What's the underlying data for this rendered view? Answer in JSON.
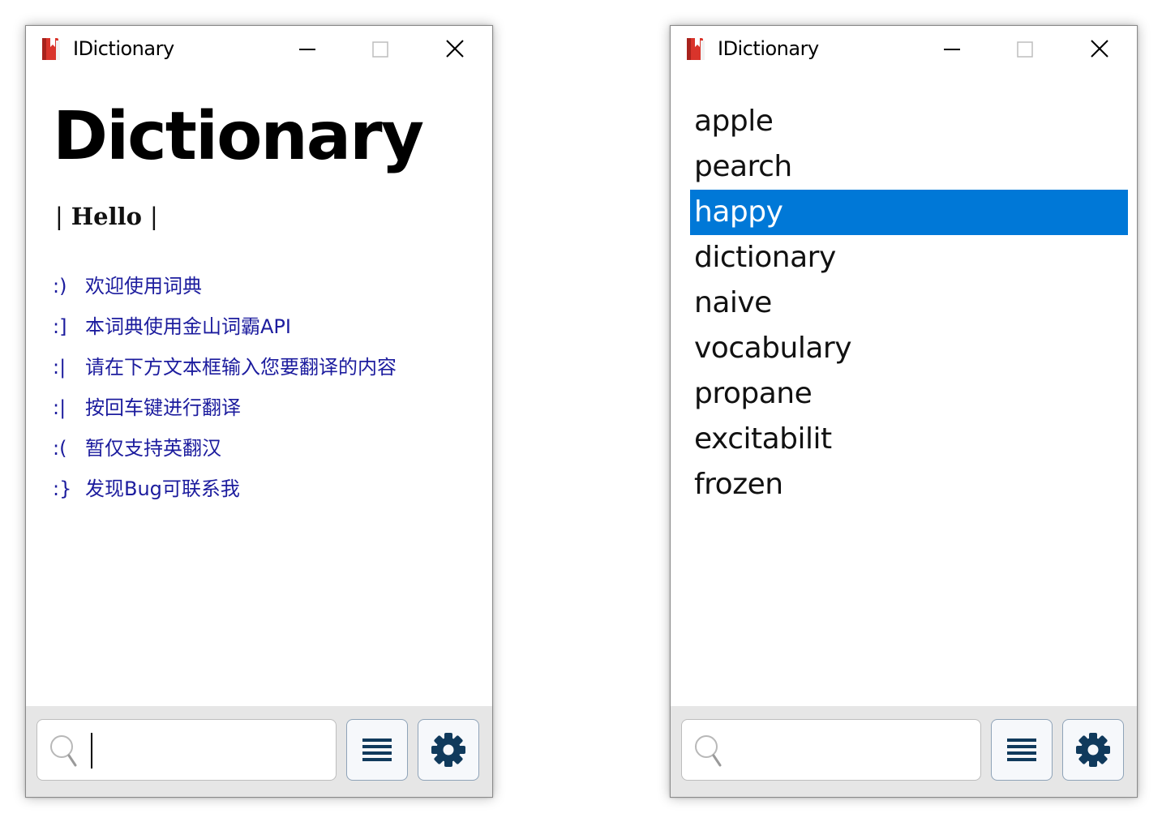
{
  "colors": {
    "accent": "#0078d7",
    "info_text": "#1c1c9e",
    "icon_red": "#d9342b",
    "toolbar_icon": "#103a5c"
  },
  "left_window": {
    "title": "IDictionary",
    "heading": "Dictionary",
    "greeting": {
      "left_bar": "|",
      "text": "Hello",
      "right_bar": "|"
    },
    "lines": [
      {
        "emoticon": ":)",
        "text": "欢迎使用词典"
      },
      {
        "emoticon": ":]",
        "text": "本词典使用金山词霸API"
      },
      {
        "emoticon": ":|",
        "text": "请在下方文本框输入您要翻译的内容"
      },
      {
        "emoticon": ":|",
        "text": "按回车键进行翻译"
      },
      {
        "emoticon": ":(",
        "text": "暂仅支持英翻汉"
      },
      {
        "emoticon": ":}",
        "text": "发现Bug可联系我"
      }
    ],
    "search": {
      "value": "",
      "placeholder": ""
    }
  },
  "right_window": {
    "title": "IDictionary",
    "words": [
      "apple",
      "pearch",
      "happy",
      "dictionary",
      "naive",
      "vocabulary",
      "propane",
      "excitabilit",
      "frozen"
    ],
    "selected_word": "happy",
    "search": {
      "value": "",
      "placeholder": ""
    }
  },
  "icons": {
    "app": "dictionary-book-icon",
    "minimize": "minimize-icon",
    "maximize": "maximize-icon",
    "close": "close-icon",
    "search": "search-icon",
    "list": "list-icon",
    "settings": "gear-icon"
  }
}
